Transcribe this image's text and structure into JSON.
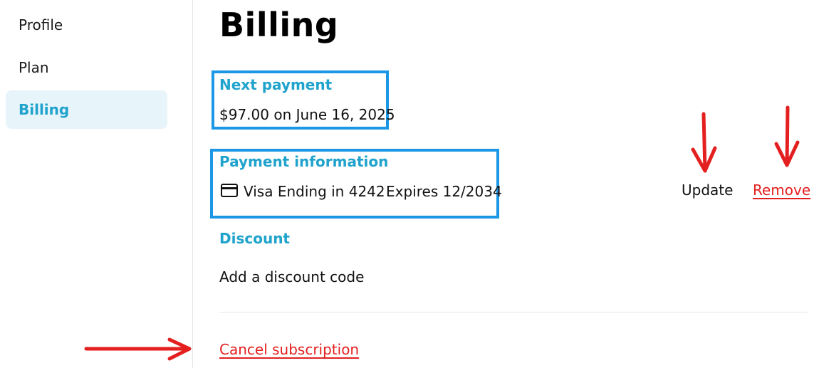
{
  "sidebar": {
    "items": [
      {
        "label": "Profile",
        "active": false
      },
      {
        "label": "Plan",
        "active": false
      },
      {
        "label": "Billing",
        "active": true
      }
    ]
  },
  "page": {
    "title": "Billing"
  },
  "next_payment": {
    "label": "Next payment",
    "value": "$97.00 on June 16, 2025"
  },
  "payment_information": {
    "label": "Payment information",
    "card_icon": "credit-card-icon",
    "card_text": "Visa Ending in 4242",
    "expires_text": "Expires 12/2034",
    "update_label": "Update",
    "remove_label": "Remove"
  },
  "discount": {
    "label": "Discount",
    "add_label": "Add a discount code"
  },
  "cancel": {
    "label": "Cancel subscription"
  },
  "colors": {
    "accent": "#1fa3cc",
    "highlight_box": "#1c97e6",
    "annotation_arrow": "#e41f1f",
    "danger": "#e41f1f",
    "active_nav_bg": "#e7f4fa"
  }
}
